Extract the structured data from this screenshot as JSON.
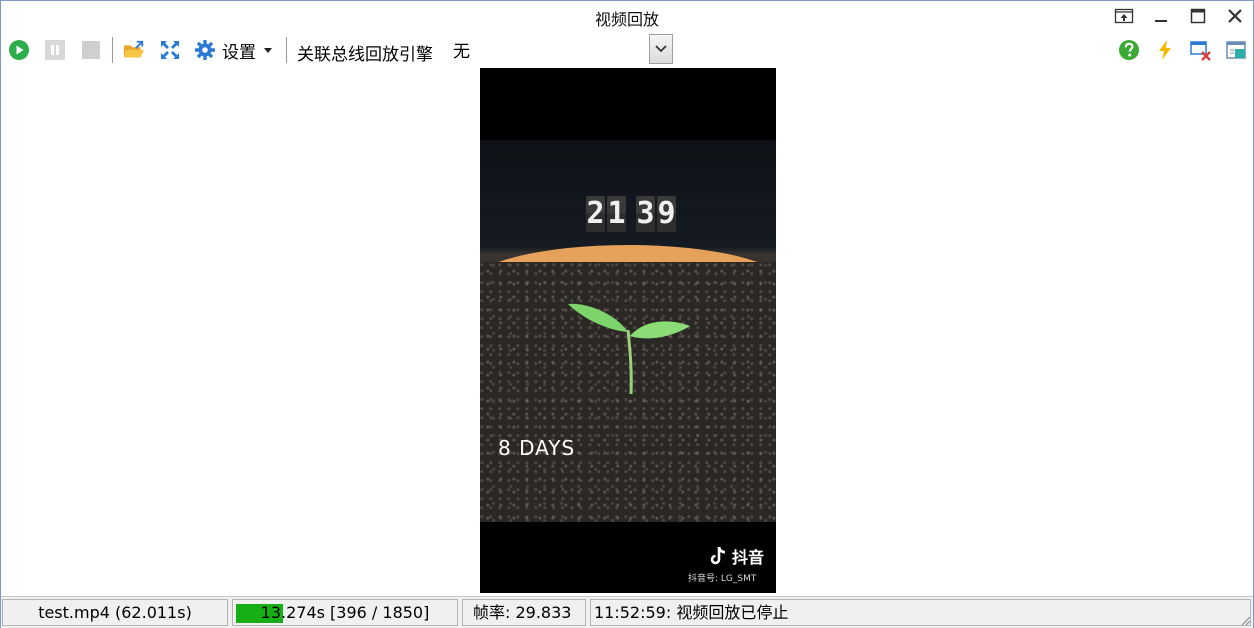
{
  "window": {
    "title": "视频回放"
  },
  "toolbar": {
    "settings_label": "设置",
    "engine_label": "关联总线回放引擎",
    "engine_value": "无"
  },
  "video": {
    "clock_digits": [
      "2",
      "1",
      "3",
      "9"
    ],
    "days_text": "8   DAYS",
    "watermark_brand": "抖音",
    "watermark_id": "抖音号: LG_SMT"
  },
  "status": {
    "file": "test.mp4 (62.011s)",
    "progress_text": "13.274s [396 / 1850]",
    "progress_fraction": 0.214,
    "frame_rate": "帧率: 29.833",
    "message": "11:52:59: 视频回放已停止"
  },
  "colors": {
    "play_green": "#2eae4b",
    "progress_green": "#16b016",
    "accent_blue": "#2a7ad5",
    "help_green": "#3aaa35",
    "lightning_yellow": "#f5b800"
  },
  "icons": {
    "play": "play-icon",
    "pause": "pause-icon",
    "stop": "stop-icon",
    "open": "open-folder-icon",
    "fullscreen": "fullscreen-icon",
    "settings": "gear-icon",
    "help": "help-icon",
    "lightning": "lightning-icon",
    "close_window": "close-window-icon",
    "export": "export-icon"
  }
}
